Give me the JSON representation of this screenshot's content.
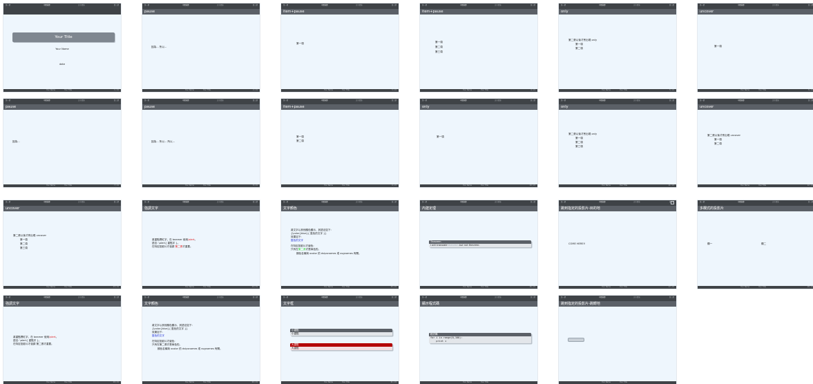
{
  "nav": {
    "left": "第一節",
    "center": "中間章節",
    "right_section": "文字環境",
    "right": "第三節"
  },
  "footer": {
    "author": "Your Name",
    "title": "Your Title"
  },
  "slides": [
    {
      "frametitle": "",
      "page": "1 / 21",
      "title_bar": "Your Title",
      "lines": [
        "Your Name",
        "date"
      ]
    },
    {
      "frametitle": "pause",
      "page": "2 / 21",
      "lines": [
        "因為... 所以..."
      ]
    },
    {
      "frametitle": "item+pause",
      "page": "3 / 21",
      "lines": [
        "第一項"
      ]
    },
    {
      "frametitle": "item+pause",
      "page": "4 / 21",
      "lines": [
        "第一項",
        "第二項",
        "第三項"
      ]
    },
    {
      "frametitle": "only",
      "page": "5 / 21",
      "lines": [
        "第二張以後才會出現 only",
        "第一項",
        "第二項"
      ]
    },
    {
      "frametitle": "uncover",
      "page": "6 / 21",
      "lines": [
        "第一項"
      ]
    },
    {
      "frametitle": "pause",
      "page": "7 / 21",
      "lines": [
        "因為..."
      ]
    },
    {
      "frametitle": "pause",
      "page": "8 / 21",
      "lines": [
        "因為... 所以... 所以..."
      ]
    },
    {
      "frametitle": "item+pause",
      "page": "9 / 21",
      "lines": [
        "第一項",
        "第二項"
      ]
    },
    {
      "frametitle": "only",
      "page": "10 / 21",
      "lines": [
        "第一項"
      ]
    },
    {
      "frametitle": "only",
      "page": "11 / 21",
      "lines": [
        "第二張以後才會出現 only",
        "第一項",
        "第二項",
        "第三項"
      ]
    },
    {
      "frametitle": "uncover",
      "page": "12 / 21",
      "lines": [
        "第二張以後才會出現 uncover",
        "第一項",
        "第二項"
      ]
    },
    {
      "frametitle": "uncover",
      "page": "13 / 21",
      "lines": [
        "第二張以後才會出現 uncover",
        "第一項",
        "第二項",
        "第三項"
      ]
    },
    {
      "frametitle": "強調文字",
      "page": "14 / 21",
      "l1a": "將重點標紅字，在 beamer 使用",
      "l1b": "\\alert",
      "l1c": "。",
      "l2": "語法: \\alert{ 重點字 }。",
      "l3a": "在特定投影片才強調 ",
      "l3b": "第二張",
      "l3c": "才重要。"
    },
    {
      "frametitle": "文字顏色",
      "page": "15 / 21",
      "l1": "將文字以其他顏色顯示，其語法如下:",
      "l2": "{\\color{blue}{ 藍色的文字 }}",
      "l3": "效果如下:",
      "l4": "藍色的文字",
      "l5": "在特定投影片才變色:",
      "l6a": "只有在",
      "l6b": "第二張",
      "l6c": "才是綠色的。",
      "l7": "顏色名稱與 xcolor 的 dvipsnames 或 svgnames 有關。"
    },
    {
      "frametitle": "內建定理",
      "page": "16 / 21",
      "head": "Theorem",
      "b1": "I will translate ",
      "b2": "theorem",
      "b3": " but not theorem."
    },
    {
      "frametitle": "跳到指定的投影片-目的地",
      "page": "17 / 21",
      "lines": [
        "COME HERE!!"
      ]
    },
    {
      "frametitle": "多欄式的投影片",
      "page": "18 / 21",
      "col1": "欄一",
      "col2": "欄二"
    },
    {
      "frametitle": "強調文字",
      "page": "19 / 21",
      "l1a": "將重點標紅字，在 beamer 使用",
      "l1b": "\\alert",
      "l1c": "。",
      "l2": "語法: \\alert{ 重點字 }。",
      "l3a": "在特定投影片才強調 ",
      "l3b": "第二張",
      "l3c": "才重要。"
    },
    {
      "frametitle": "文字顏色",
      "page": "20 / 21",
      "l1": "將文字以其他顏色顯示，其語法如下:",
      "l2": "{\\color{blue}{ 藍色的文字 }}",
      "l3": "效果如下:",
      "l4": "藍色的文字",
      "l5": "在特定投影片才變色:",
      "l6": "只有在第二張才是綠色的。",
      "l7": "顏色名稱與 xcolor 的 dvipsnames 或 svgnames 有關。"
    },
    {
      "frametitle": "文字框",
      "page": "21 / 21",
      "h1": "小重點",
      "b1": "小重點",
      "h2": "大重點",
      "b2": "大重點"
    },
    {
      "frametitle": "顯示程式碼",
      "page": "",
      "head": "程式碼",
      "code1": "for i in range(0,100):",
      "code2": "    print i"
    },
    {
      "frametitle": "跳到指定的投影片-跳轉地",
      "page": ""
    }
  ],
  "colors": {
    "header": "#3f4347",
    "frametitle": "#5b6067",
    "slide_bg": "#eef6fd",
    "alert": "#e0191b",
    "blue": "#1f2fd6",
    "green": "#2bdc2b",
    "alertblock": "#b30000"
  }
}
